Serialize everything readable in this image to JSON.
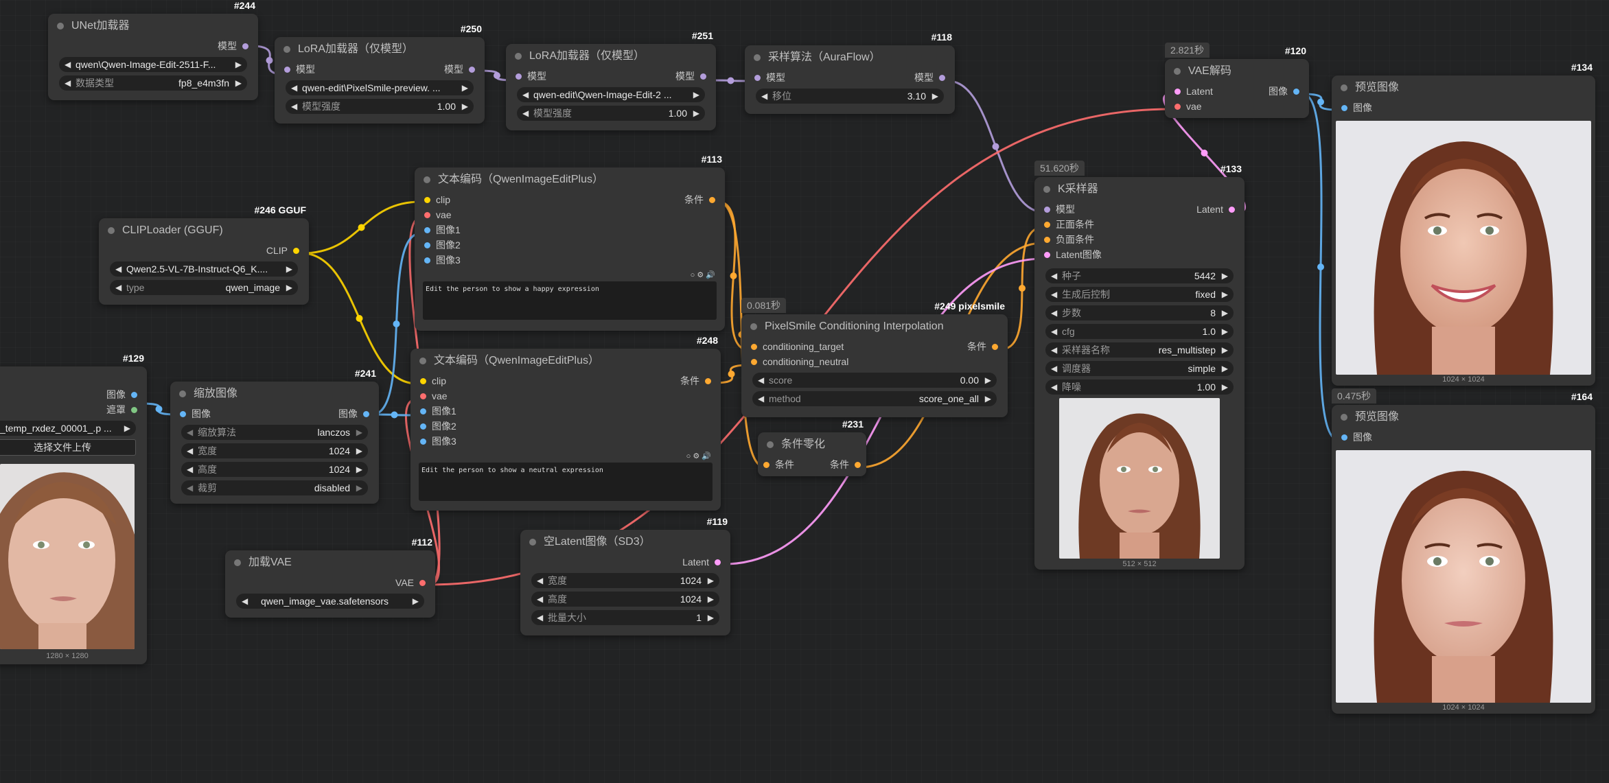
{
  "colors": {
    "model": "#b39ddb",
    "clip": "#ffd500",
    "vae": "#ff6e6e",
    "image": "#64b5f6",
    "conditioning": "#ffa931",
    "latent": "#ff9cf9",
    "mask": "#81c784"
  },
  "nodes": {
    "unet": {
      "id": "#244",
      "title": "UNet加载器",
      "out_model": "模型",
      "unet_name": "qwen\\Qwen-Image-Edit-2511-F...",
      "dtype_label": "数据类型",
      "dtype": "fp8_e4m3fn"
    },
    "lora1": {
      "id": "#250",
      "title": "LoRA加载器（仅模型）",
      "in_model": "模型",
      "out_model": "模型",
      "lora_name": "qwen-edit\\PixelSmile-preview. ...",
      "strength_label": "模型强度",
      "strength": "1.00"
    },
    "lora2": {
      "id": "#251",
      "title": "LoRA加载器（仅模型）",
      "in_model": "模型",
      "out_model": "模型",
      "lora_name": "qwen-edit\\Qwen-Image-Edit-2 ...",
      "strength_label": "模型强度",
      "strength": "1.00"
    },
    "sampling": {
      "id": "#118",
      "title": "采样算法（AuraFlow）",
      "in_model": "模型",
      "out_model": "模型",
      "shift_label": "移位",
      "shift": "3.10"
    },
    "vaedecode": {
      "id": "#120",
      "time": "2.821秒",
      "title": "VAE解码",
      "in_latent": "Latent",
      "in_vae": "vae",
      "out_image": "图像"
    },
    "preview1": {
      "id": "#134",
      "title": "预览图像",
      "in_image": "图像",
      "caption": "1024 × 1024"
    },
    "preview2": {
      "id": "#164",
      "time": "0.475秒",
      "title": "预览图像",
      "in_image": "图像",
      "caption": "1024 × 1024"
    },
    "clip": {
      "id": "#246 GGUF",
      "title": "CLIPLoader (GGUF)",
      "out_clip": "CLIP",
      "clip_name": "Qwen2.5-VL-7B-Instruct-Q6_K....",
      "type_label": "type",
      "type": "qwen_image"
    },
    "enc1": {
      "id": "#113",
      "title": "文本编码（QwenImageEditPlus）",
      "in_clip": "clip",
      "in_vae": "vae",
      "in_img1": "图像1",
      "in_img2": "图像2",
      "in_img3": "图像3",
      "out_cond": "条件",
      "prompt": "Edit the person to show a happy expression"
    },
    "enc2": {
      "id": "#248",
      "title": "文本编码（QwenImageEditPlus）",
      "in_clip": "clip",
      "in_vae": "vae",
      "in_img1": "图像1",
      "in_img2": "图像2",
      "in_img3": "图像3",
      "out_cond": "条件",
      "prompt": "Edit the person to show a neutral expression"
    },
    "ksampler": {
      "id": "#133",
      "time": "51.620秒",
      "title": "K采样器",
      "in_model": "模型",
      "in_pos": "正面条件",
      "in_neg": "负面条件",
      "in_latent": "Latent图像",
      "out_latent": "Latent",
      "widgets": [
        {
          "label": "种子",
          "value": "5442"
        },
        {
          "label": "生成后控制",
          "value": "fixed"
        },
        {
          "label": "步数",
          "value": "8"
        },
        {
          "label": "cfg",
          "value": "1.0"
        },
        {
          "label": "采样器名称",
          "value": "res_multistep"
        },
        {
          "label": "调度器",
          "value": "simple"
        },
        {
          "label": "降噪",
          "value": "1.00"
        }
      ],
      "caption": "512 × 512"
    },
    "loadimg": {
      "id": "#129",
      "out_image": "图像",
      "out_mask": "遮罩",
      "file": "_temp_rxdez_00001_.p ...",
      "upload": "选择文件上传",
      "caption": "1280 × 1280"
    },
    "scale": {
      "id": "#241",
      "title": "缩放图像",
      "in_image": "图像",
      "out_image": "图像",
      "widgets": [
        {
          "label": "缩放算法",
          "value": "lanczos"
        },
        {
          "label": "宽度",
          "value": "1024"
        },
        {
          "label": "高度",
          "value": "1024"
        },
        {
          "label": "裁剪",
          "value": "disabled"
        }
      ]
    },
    "pixelsmile": {
      "id": "#249 pixelsmile",
      "time": "0.081秒",
      "title": "PixelSmile Conditioning Interpolation",
      "in_target": "conditioning_target",
      "in_neutral": "conditioning_neutral",
      "out_cond": "条件",
      "score_label": "score",
      "score": "0.00",
      "method_label": "method",
      "method": "score_one_all"
    },
    "zero": {
      "id": "#231",
      "title": "条件零化",
      "in_cond": "条件",
      "out_cond": "条件"
    },
    "vaeload": {
      "id": "#112",
      "title": "加载VAE",
      "out_vae": "VAE",
      "vae_name": "qwen_image_vae.safetensors"
    },
    "emptylatent": {
      "id": "#119",
      "title": "空Latent图像（SD3）",
      "out_latent": "Latent",
      "widgets": [
        {
          "label": "宽度",
          "value": "1024"
        },
        {
          "label": "高度",
          "value": "1024"
        },
        {
          "label": "批量大小",
          "value": "1"
        }
      ]
    }
  }
}
